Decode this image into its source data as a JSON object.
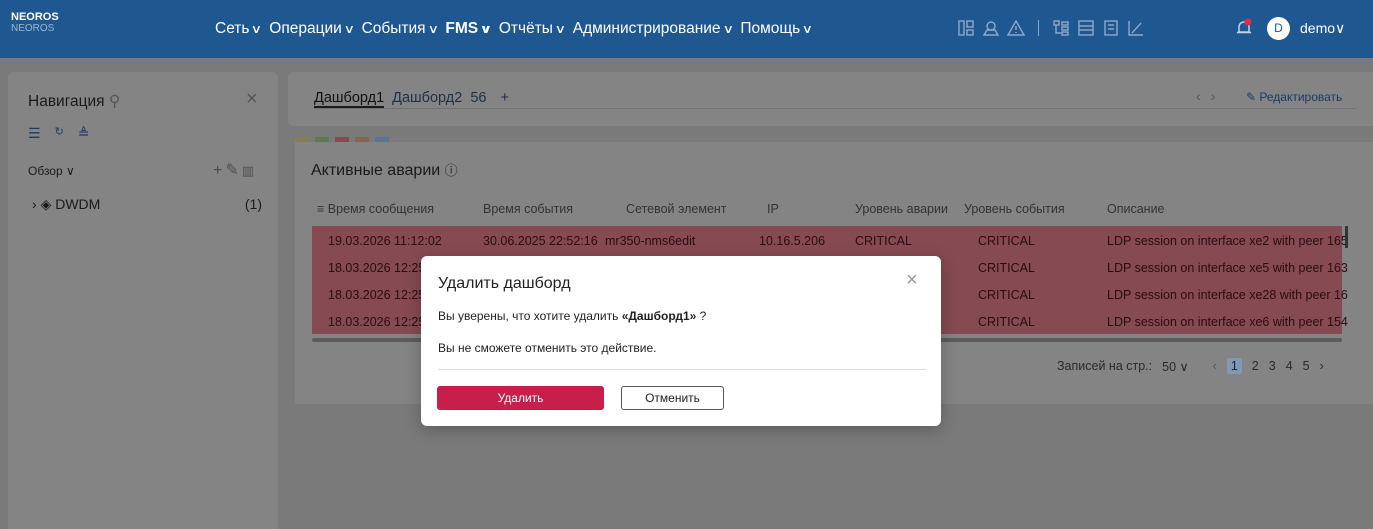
{
  "brand": {
    "name": "NEOROS",
    "sub": "NEOROS"
  },
  "menu": [
    {
      "label": "Сеть",
      "bold": false
    },
    {
      "label": "Операции",
      "bold": false
    },
    {
      "label": "События",
      "bold": false
    },
    {
      "label": "FMS",
      "bold": true
    },
    {
      "label": "Отчёты",
      "bold": false
    },
    {
      "label": "Администрирование",
      "bold": false
    },
    {
      "label": "Помощь",
      "bold": false
    }
  ],
  "user": {
    "initial": "D",
    "name": "demo"
  },
  "sidebar": {
    "title": "Навигация",
    "view_label": "Обзор",
    "tree": [
      {
        "label": "DWDM",
        "count": "(1)"
      }
    ]
  },
  "tabs": {
    "items": [
      "Дашборд1",
      "Дашборд2",
      "56"
    ],
    "add": "+",
    "edit": "Редактировать"
  },
  "widget": {
    "title": "Активные аварии",
    "columns": [
      "Время сообщения",
      "Время события",
      "Сетевой элемент",
      "IP",
      "Уровень аварии",
      "Уровень события",
      "Описание"
    ],
    "rows": [
      [
        "19.03.2026 11:12:02",
        "30.06.2025 22:52:16",
        "mr350-nms6edit",
        "10.16.5.206",
        "CRITICAL",
        "CRITICAL",
        "LDP session on interface xe2 with peer 165"
      ],
      [
        "18.03.2026 12:25",
        "",
        "",
        "",
        "",
        "CRITICAL",
        "LDP session on interface xe5 with peer 163"
      ],
      [
        "18.03.2026 12:25",
        "",
        "",
        "",
        "",
        "CRITICAL",
        "LDP session on interface xe28 with peer 16"
      ],
      [
        "18.03.2026 12:25",
        "",
        "",
        "",
        "",
        "CRITICAL",
        "LDP session on interface xe6 with peer 154"
      ]
    ],
    "pager": {
      "per_page_label": "Записей на стр.:",
      "per_page": "50",
      "pages": [
        "1",
        "2",
        "3",
        "4",
        "5"
      ]
    }
  },
  "modal": {
    "title": "Удалить дашборд",
    "text_prefix": "Вы уверены, что хотите удалить ",
    "text_name": "«Дашборд1»",
    "text_suffix": " ?",
    "warning": "Вы не сможете отменить это действие.",
    "delete_label": "Удалить",
    "cancel_label": "Отменить"
  }
}
